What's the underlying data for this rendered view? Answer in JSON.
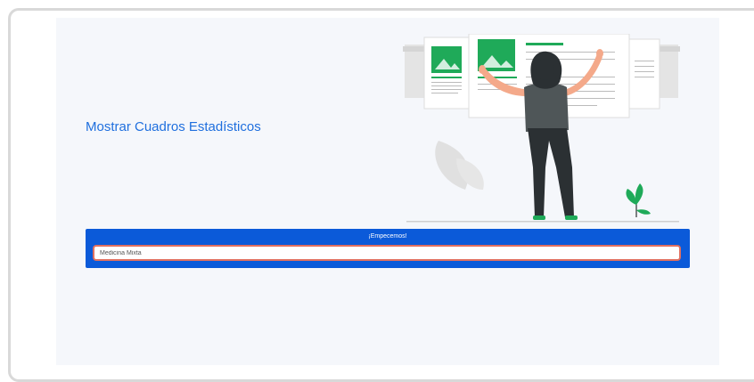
{
  "hero": {
    "title": "Mostrar Cuadros Estadísticos"
  },
  "selector": {
    "label": "¡Empecemos!",
    "value": "Medicina Mixta"
  },
  "illustration": {
    "name": "woman-arranging-cards-illustration",
    "accent_color": "#1faa59",
    "figure_color": "#2b3033",
    "skin_color": "#f4a98a"
  },
  "colors": {
    "title": "#1f6fde",
    "bar": "#0b5ad9",
    "field_border": "#e07060",
    "panel_background": "#f5f7fb"
  }
}
